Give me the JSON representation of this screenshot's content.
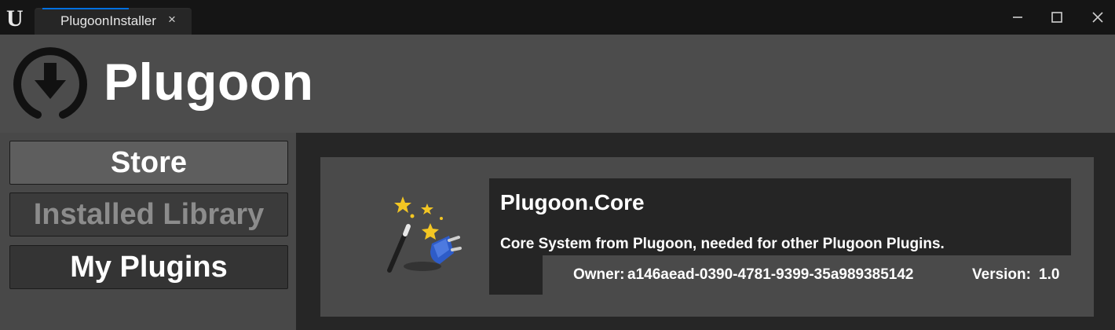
{
  "window": {
    "tab_title": "PlugoonInstaller",
    "tab_close": "×",
    "logo_letter": "U"
  },
  "header": {
    "app_name": "Plugoon",
    "logo_icon": "download-circle-icon"
  },
  "sidebar": {
    "items": [
      {
        "label": "Store",
        "state": "selected"
      },
      {
        "label": "Installed Library",
        "state": "disabled"
      },
      {
        "label": "My Plugins",
        "state": "normal"
      }
    ]
  },
  "plugin": {
    "name": "Plugoon.Core",
    "description": "Core System from Plugoon, needed for other Plugoon Plugins.",
    "owner_label": "Owner:",
    "owner": "a146aead-0390-4781-9399-35a989385142",
    "version_label": "Version:",
    "version": "1.0",
    "icon": "magic-wand-plug-icon"
  },
  "colors": {
    "accent": "#0070e0",
    "panel": "#4a4a4a",
    "dark_panel": "#252525"
  }
}
